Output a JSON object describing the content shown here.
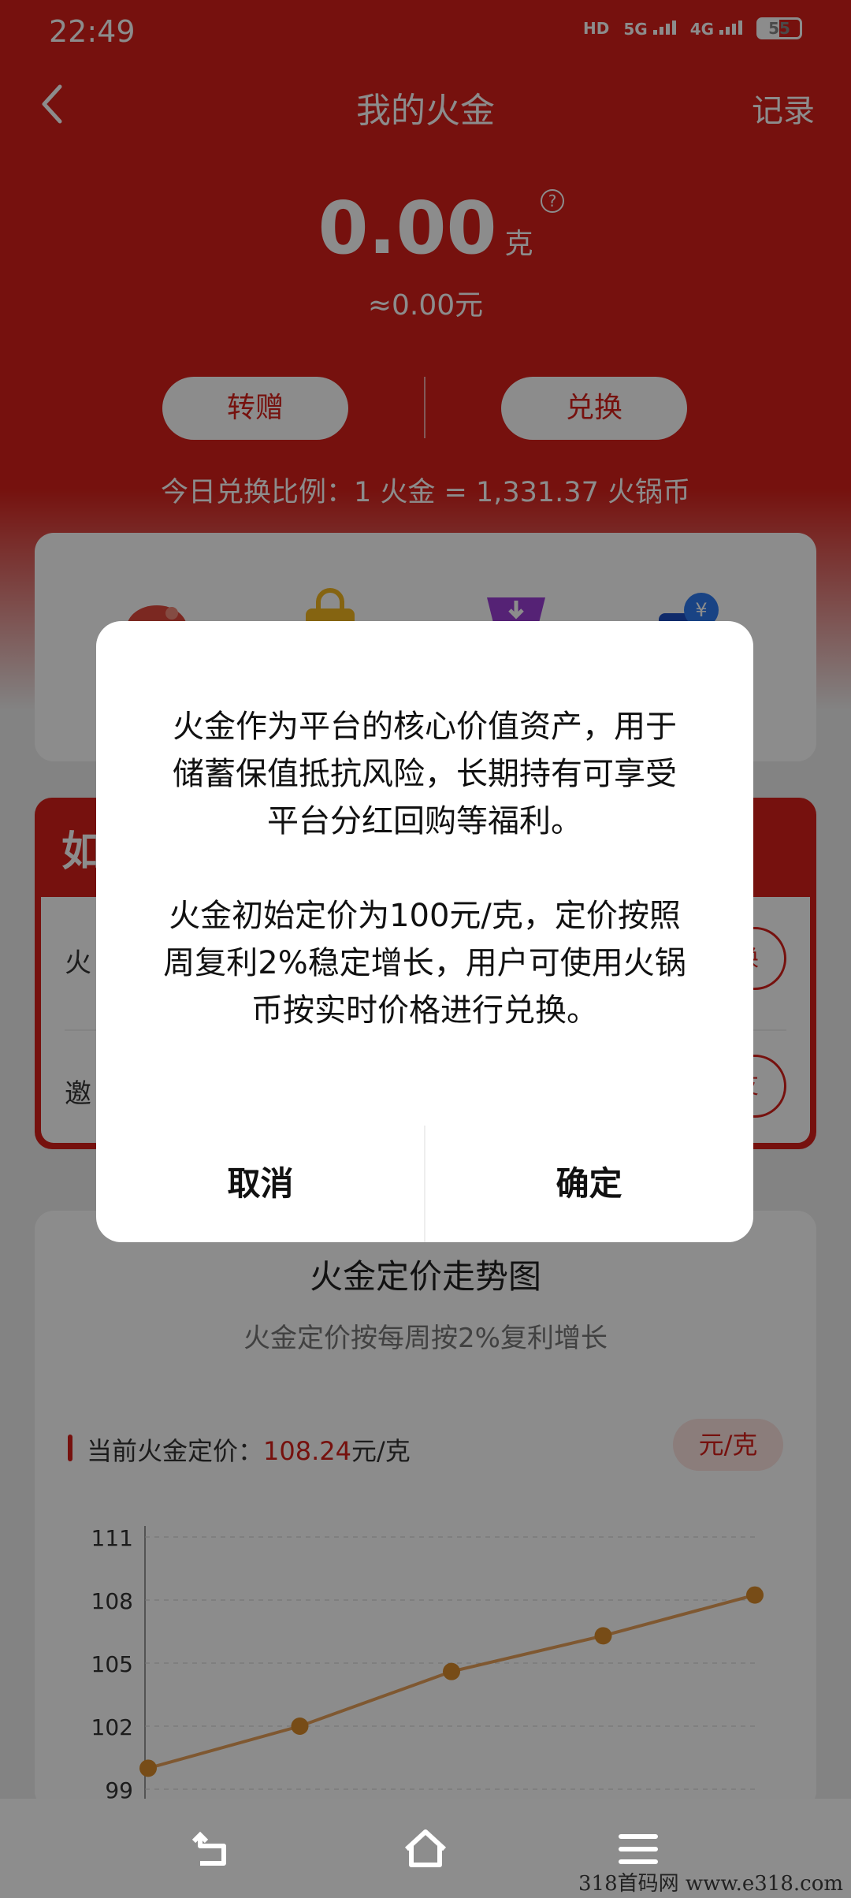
{
  "status": {
    "time": "22:49",
    "hd": "HD",
    "net1": "5G",
    "net2": "4G",
    "battery": "55"
  },
  "nav": {
    "title": "我的火金",
    "record": "记录"
  },
  "balance": {
    "amount": "0.00",
    "unit": "克",
    "help": "?",
    "approx": "≈0.00元"
  },
  "actions": {
    "gift": "转赠",
    "exchange": "兑换"
  },
  "ratio": "今日兑换比例：1 火金 = 1,331.37 火锅币",
  "earn": {
    "head": "如",
    "row1": "火",
    "row1_btn": "换",
    "row2": "邀",
    "row2_btn": "友"
  },
  "price_card": {
    "title": "火金定价走势图",
    "subtitle": "火金定价按每周按2%复利增长",
    "current_label": "当前火金定价：",
    "current_price": "108.24",
    "current_unit": "元/克",
    "unit_btn": "元/克"
  },
  "chart_data": {
    "type": "line",
    "y_ticks": [
      "111",
      "108",
      "105",
      "102",
      "99"
    ],
    "ylim": [
      99,
      111
    ],
    "values": [
      100,
      102,
      104.6,
      106.3,
      108.24
    ],
    "grid": true,
    "line_color": "#e8a15a",
    "point_color": "#d98a2a"
  },
  "dialog": {
    "p1": "火金作为平台的核心价值资产，用于储蓄保值抵抗风险，长期持有可享受平台分红回购等福利。",
    "p2": "火金初始定价为100元/克，定价按照周复利2%稳定增长，用户可使用火锅币按实时价格进行兑换。",
    "cancel": "取消",
    "confirm": "确定"
  },
  "watermark": "318首码网  www.e318.com",
  "colors": {
    "brand": "#d7201a"
  }
}
